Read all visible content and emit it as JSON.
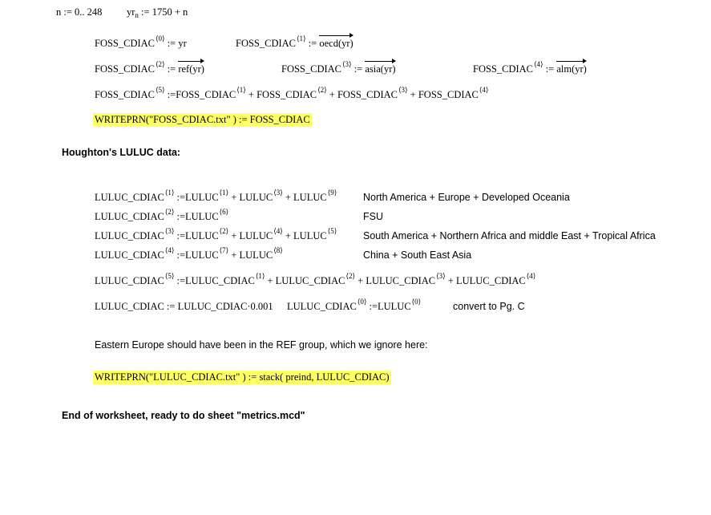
{
  "defs": {
    "range": "n := 0.. 248",
    "yr_lhs": "yr",
    "yr_sub": "n",
    "yr_rhs": ":= 1750 + n"
  },
  "foss": {
    "var": "FOSS_CDIAC",
    "assign": ":=",
    "plus": "+",
    "idx0": "⟨0⟩",
    "idx1": "⟨1⟩",
    "idx2": "⟨2⟩",
    "idx3": "⟨3⟩",
    "idx4": "⟨4⟩",
    "idx5": "⟨5⟩",
    "yr": "yr",
    "oecd": "oecd(yr)",
    "ref": "ref(yr)",
    "asia": "asia(yr)",
    "alm": "alm(yr)",
    "write_expr": "WRITEPRN(\"FOSS_CDIAC.txt\" ) := FOSS_CDIAC"
  },
  "luluc_heading": "Houghton's LULUC data:",
  "luluc": {
    "var": "LULUC_CDIAC",
    "src": "LULUC",
    "assign": ":=",
    "plus": "+",
    "i0": "⟨0⟩",
    "i1": "⟨1⟩",
    "i2": "⟨2⟩",
    "i3": "⟨3⟩",
    "i4": "⟨4⟩",
    "i5": "⟨5⟩",
    "i6": "⟨6⟩",
    "i7": "⟨7⟩",
    "i8": "⟨8⟩",
    "i9": "⟨9⟩",
    "note1": "North America + Europe + Developed Oceania",
    "note2": "FSU",
    "note3": "South America + Northern Africa and middle East + Tropical Africa",
    "note4": "China + South East Asia",
    "scale_expr": "LULUC_CDIAC := LULUC_CDIAC·0.001",
    "convert_note": "convert to Pg. C",
    "comment": "Eastern Europe should have been in the REF group, which we ignore here:",
    "write_expr": "WRITEPRN(\"LULUC_CDIAC.txt\" ) := stack( preind, LULUC_CDIAC)"
  },
  "end_text": "End of worksheet, ready to do sheet \"metrics.mcd\""
}
